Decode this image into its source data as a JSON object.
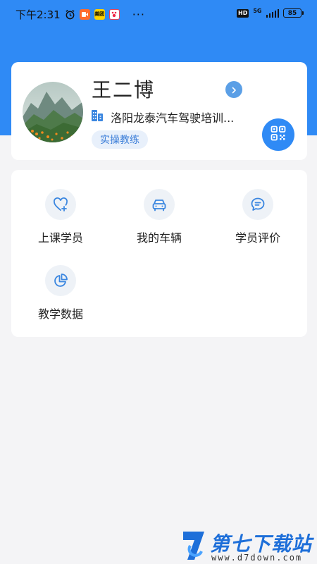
{
  "status_bar": {
    "time": "下午2:31",
    "app_icons": [
      "alarm-icon",
      "video-app-icon",
      "meituan-app-icon",
      "baidu-app-icon"
    ],
    "meituan_label": "美团",
    "more": "···",
    "network": "5G",
    "battery": "85"
  },
  "profile": {
    "name": "王二博",
    "organization": "洛阳龙泰汽车驾驶培训...",
    "role_tag": "实操教练"
  },
  "menu": {
    "items": [
      {
        "label": "上课学员",
        "icon": "student-heart-icon"
      },
      {
        "label": "我的车辆",
        "icon": "car-icon"
      },
      {
        "label": "学员评价",
        "icon": "comment-icon"
      },
      {
        "label": "教学数据",
        "icon": "pie-chart-icon"
      }
    ]
  },
  "watermark": {
    "title": "第七下载站",
    "url": "www.d7down.com"
  },
  "colors": {
    "header_blue": "#2f8af5",
    "icon_blue": "#3a86e0",
    "tag_bg": "#e8f0fb"
  }
}
